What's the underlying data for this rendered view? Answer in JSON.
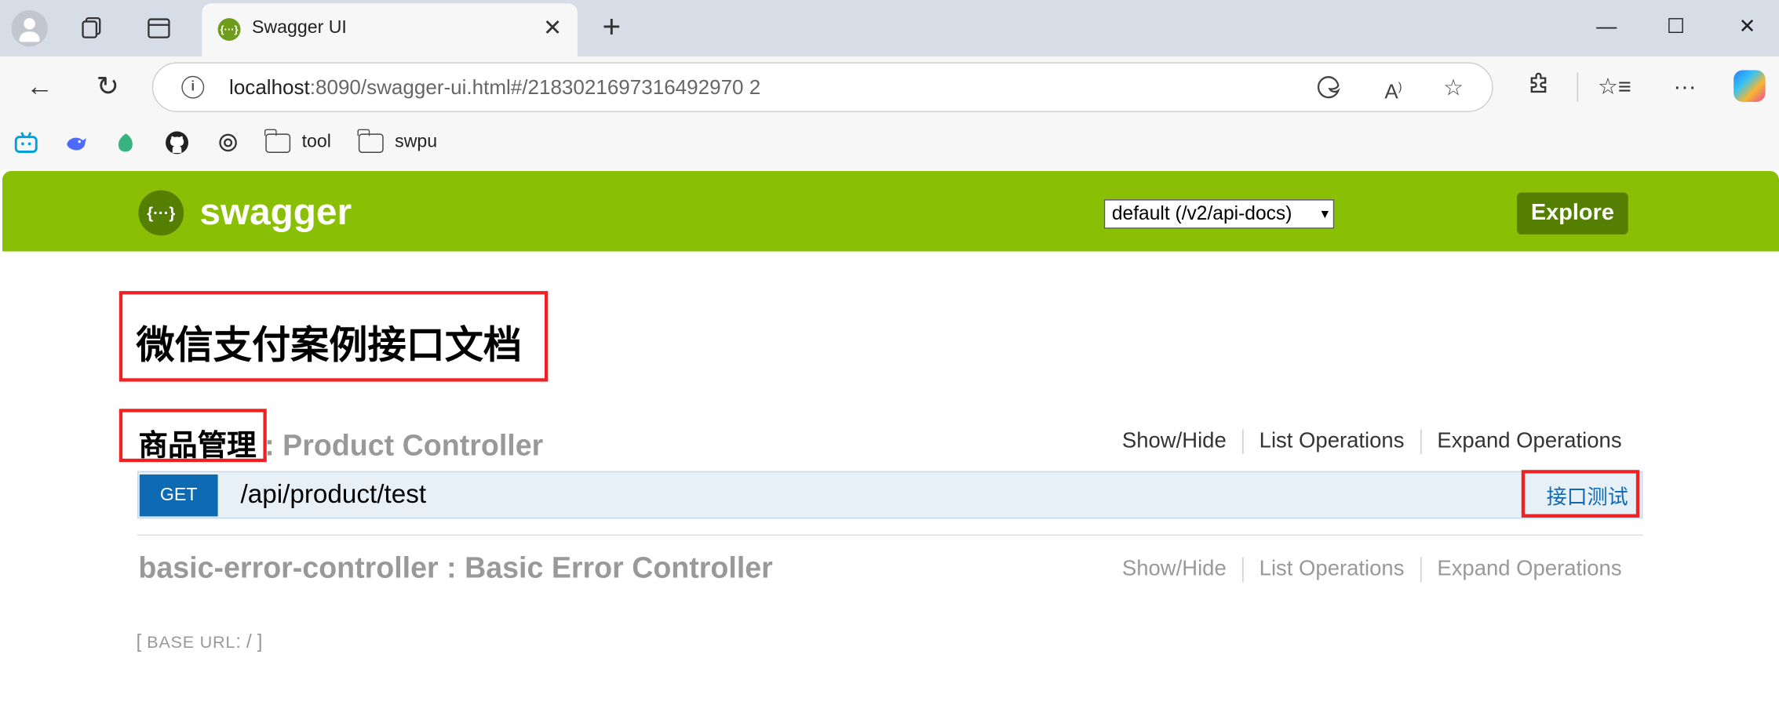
{
  "browser": {
    "tab": {
      "title": "Swagger UI",
      "favicon": "{···}"
    },
    "url": {
      "host": "localhost",
      "rest": ":8090/swagger-ui.html#/2183021697316492970 2"
    },
    "bookmarks": [
      {
        "label": "tool"
      },
      {
        "label": "swpu"
      }
    ]
  },
  "swagger": {
    "brand": "swagger",
    "logo_glyph": "{···}",
    "spec_select": "default (/v2/api-docs)",
    "explore_label": "Explore",
    "doc_title": "微信支付案例接口文档",
    "resources": [
      {
        "name_cn": "商品管理",
        "name_rest": " : Product Controller",
        "ops": [
          "Show/Hide",
          "List Operations",
          "Expand Operations"
        ],
        "endpoint": {
          "method": "GET",
          "path": "/api/product/test",
          "summary": "接口测试"
        }
      },
      {
        "name": "basic-error-controller : Basic Error Controller",
        "ops": [
          "Show/Hide",
          "List Operations",
          "Expand Operations"
        ]
      }
    ],
    "base_url_label": "BASE URL",
    "base_url_value": "/"
  },
  "colors": {
    "swagger_green": "#89bf04",
    "explore_green": "#547f00",
    "get_blue": "#0f6ab4",
    "highlight_red": "#ee2222"
  }
}
